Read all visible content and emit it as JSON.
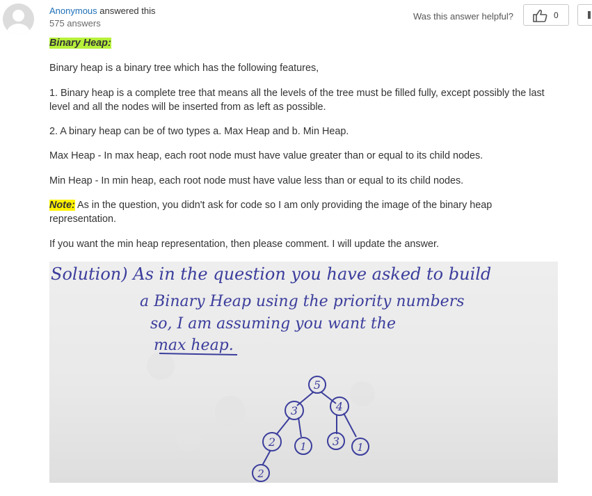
{
  "author": {
    "name": "Anonymous",
    "action": "answered this",
    "answers_count": "575 answers"
  },
  "feedback": {
    "question": "Was this answer helpful?",
    "likes": "0"
  },
  "icons": {
    "avatar": "user-avatar-icon",
    "like": "thumbs-up-icon",
    "dislike": "thumbs-down-icon"
  },
  "colors": {
    "link": "#1d6fb8",
    "heading_highlight": "#b7f13a",
    "note_highlight": "#fff200",
    "ink": "#3b3d9c"
  },
  "answer": {
    "heading": "Binary Heap:",
    "intro": "Binary heap is a binary tree which has the following features,",
    "point1": "1. Binary heap is a complete tree that means all the levels of the tree must be filled fully, except possibly the last level and all the nodes will be inserted from as left as possible.",
    "point2": "2. A binary heap can be of two types a. Max Heap and b. Min Heap.",
    "max_heap": "Max Heap - In max heap, each root node must have value greater than or equal to its child nodes.",
    "min_heap": "Min Heap - In min heap, each root node must have value less than or equal to its child nodes.",
    "note_label": "Note:",
    "note_text": " As in the question, you didn't ask for code so I am only providing the image of the binary heap representation.",
    "closing": "If you want the min heap representation, then please comment. I will update the answer."
  },
  "image": {
    "line1": "Solution) As in the question you have asked to build",
    "line2": "a Binary Heap using the priority numbers",
    "line3": "so, I am assuming you want the",
    "line4": "max heap.",
    "nodes": [
      "5",
      "3",
      "4",
      "2",
      "1",
      "3",
      "1",
      "2"
    ]
  }
}
